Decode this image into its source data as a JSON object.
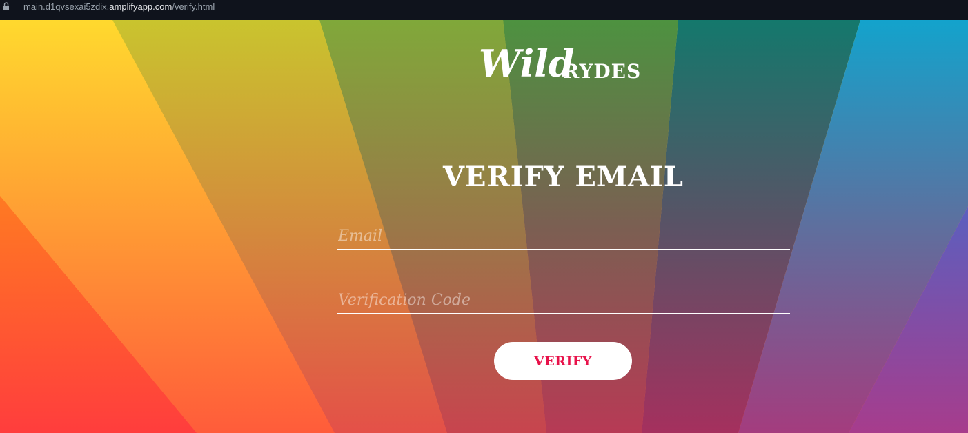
{
  "browser": {
    "url_prefix": "main.d1qvsexai5zdix.",
    "url_domain": "amplifyapp.com",
    "url_path": "/verify.html"
  },
  "logo": {
    "wordmark": "Wild",
    "wordmark_suffix": "RYDES"
  },
  "page": {
    "title": "VERIFY EMAIL"
  },
  "form": {
    "email_placeholder": "Email",
    "email_value": "",
    "code_placeholder": "Verification Code",
    "code_value": "",
    "submit_label": "VERIFY"
  },
  "colors": {
    "accent": "#e8124a",
    "text": "#ffffff"
  },
  "icons": {
    "url_lock": "lock-icon"
  }
}
